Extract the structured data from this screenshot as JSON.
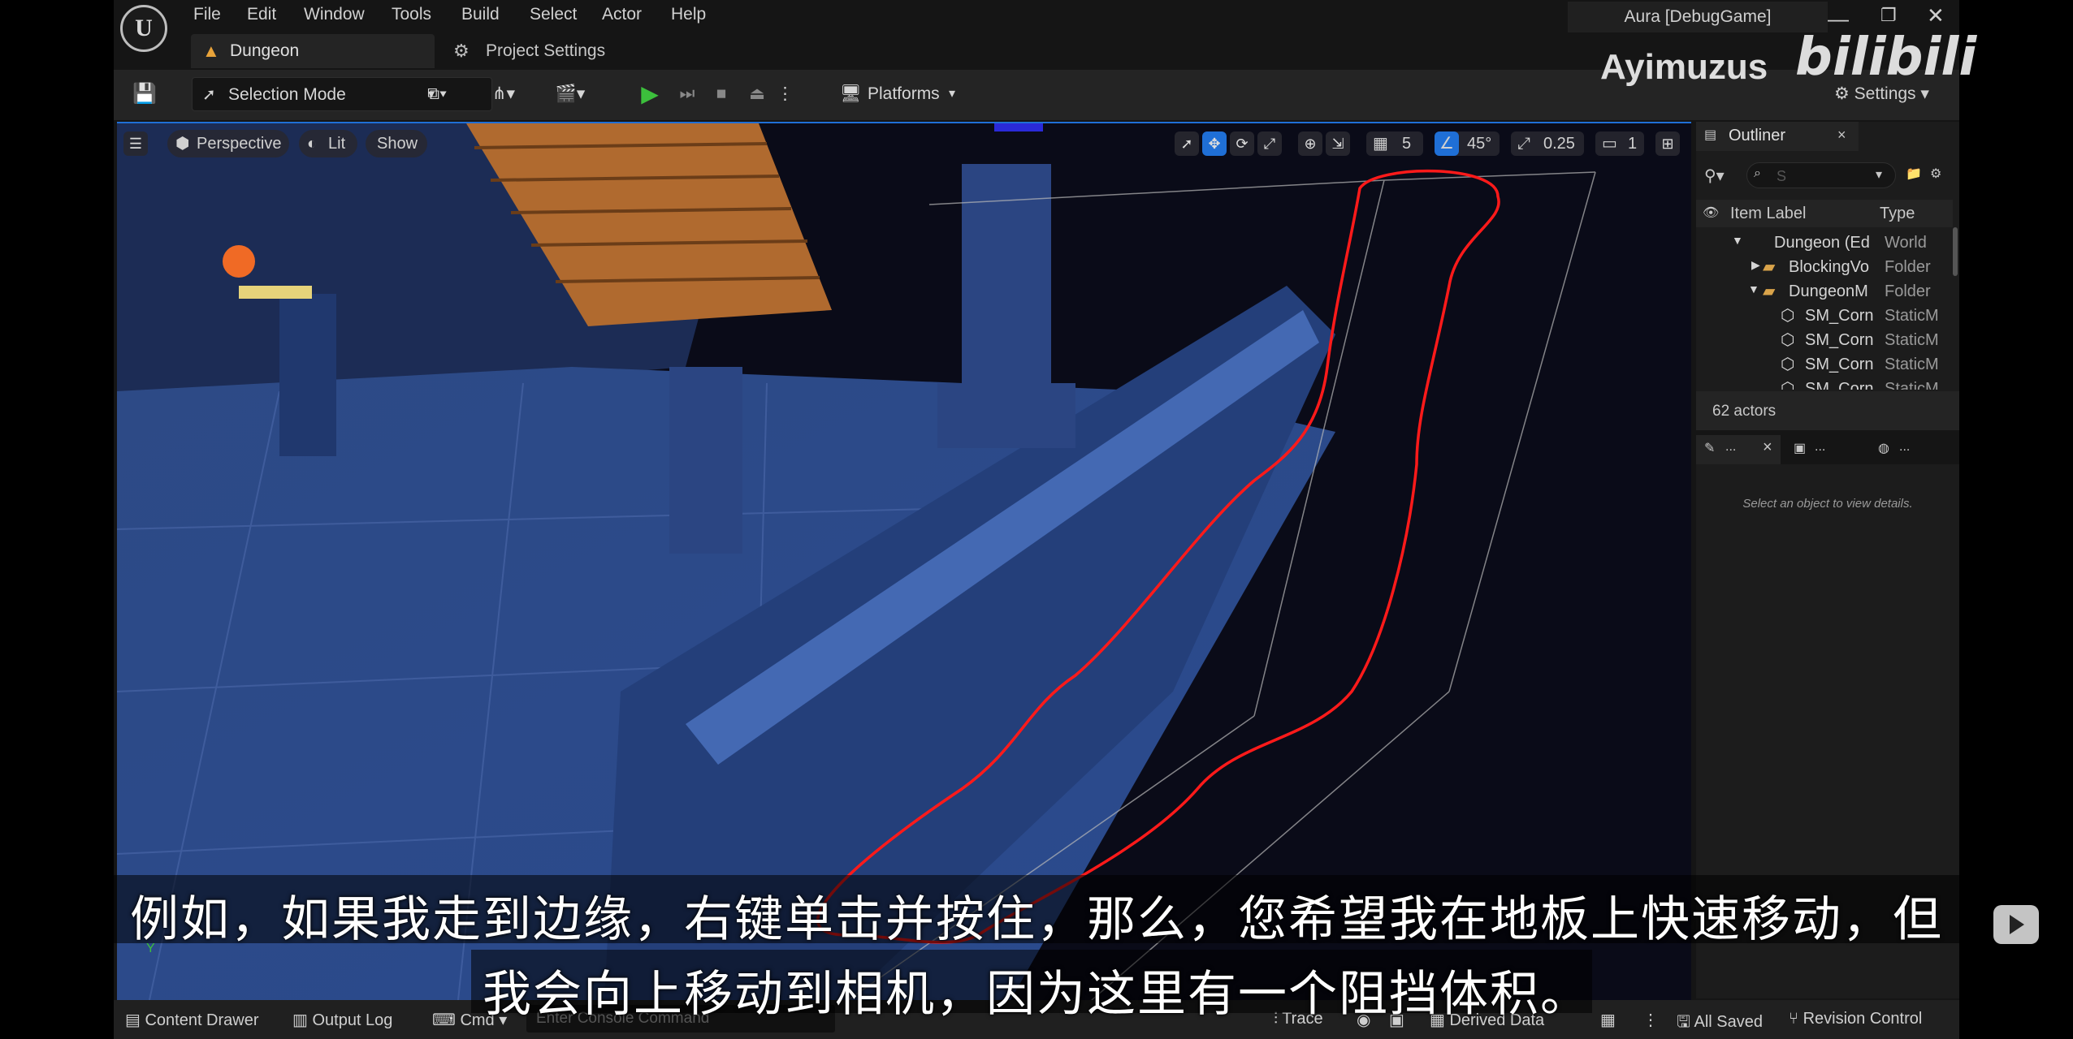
{
  "menu": [
    "File",
    "Edit",
    "Window",
    "Tools",
    "Build",
    "Select",
    "Actor",
    "Help"
  ],
  "tabs": {
    "level": "Dungeon",
    "project_settings": "Project Settings"
  },
  "window_title": "Aura [DebugGame]",
  "toolbar": {
    "selection_mode": "Selection Mode",
    "platforms": "Platforms",
    "settings": "Settings"
  },
  "viewport": {
    "perspective": "Perspective",
    "lit": "Lit",
    "show": "Show",
    "grid_snap": "5",
    "rotation_snap": "45°",
    "scale_snap": "0.25",
    "camera_speed": "1"
  },
  "outliner": {
    "title": "Outliner",
    "search_placeholder": "S",
    "col_label": "Item Label",
    "col_type": "Type",
    "rows": [
      {
        "name": "Dungeon (Ed",
        "type": "World"
      },
      {
        "name": "BlockingVo",
        "type": "Folder"
      },
      {
        "name": "DungeonM",
        "type": "Folder"
      },
      {
        "name": "SM_Corn",
        "type": "StaticM"
      },
      {
        "name": "SM_Corn",
        "type": "StaticM"
      },
      {
        "name": "SM_Corn",
        "type": "StaticM"
      },
      {
        "name": "SM_Corn",
        "type": "StaticM"
      }
    ],
    "actor_count": "62 actors"
  },
  "details": {
    "tab1": "...",
    "tab2": "...",
    "tab3": "...",
    "empty_message": "Select an object to view details."
  },
  "statusbar": {
    "content_drawer": "Content Drawer",
    "output_log": "Output Log",
    "cmd": "Cmd",
    "console_placeholder": "Enter Console Command",
    "trace": "Trace",
    "derived_data": "Derived Data",
    "all_saved": "All Saved",
    "revision_control": "Revision Control"
  },
  "overlay": {
    "watermark": "Ayimuzus",
    "brand": "bilibili",
    "subtitle_line1": "例如，如果我走到边缘，右键单击并按住，那么，您希望我在地板上快速移动，但",
    "subtitle_line2": "我会向上移动到相机，因为这里有一个阻挡体积。",
    "gizmo_y": "Y"
  },
  "colors": {
    "accent": "#1f6fd6",
    "annotation": "#ff1a1a",
    "play": "#3cbf3c"
  }
}
